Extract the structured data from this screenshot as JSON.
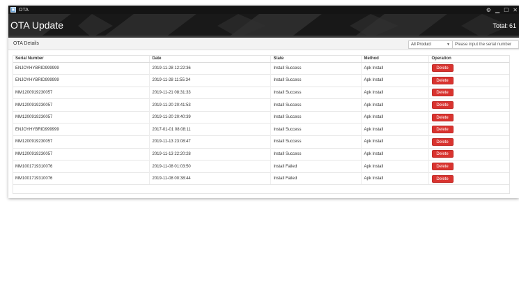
{
  "window": {
    "title": "OTA"
  },
  "header": {
    "title": "OTA Update",
    "total_label": "Total:",
    "total_value": "61"
  },
  "panel": {
    "title": "OTA Details",
    "product_select": {
      "selected": "All Product"
    },
    "serial_search": {
      "placeholder": "Please input the serial number"
    }
  },
  "table": {
    "columns": [
      "Serial Number",
      "Date",
      "State",
      "Method",
      "Operation"
    ],
    "delete_label": "Delete",
    "rows": [
      {
        "serial": "ENJOYHYBRID999999",
        "date": "2019-11-28 12:22:36",
        "state": "Install Success",
        "method": "Apk Install"
      },
      {
        "serial": "ENJOYHYBRID999999",
        "date": "2019-11-28 11:55:34",
        "state": "Install Success",
        "method": "Apk Install"
      },
      {
        "serial": "MM1200919230057",
        "date": "2019-11-21 08:31:33",
        "state": "Install Success",
        "method": "Apk Install"
      },
      {
        "serial": "MM1200919230057",
        "date": "2019-11-20 20:41:53",
        "state": "Install Success",
        "method": "Apk Install"
      },
      {
        "serial": "MM1200919230057",
        "date": "2019-11-20 20:40:39",
        "state": "Install Success",
        "method": "Apk Install"
      },
      {
        "serial": "ENJOYHYBRID999999",
        "date": "2017-01-01 08:08:11",
        "state": "Install Success",
        "method": "Apk Install"
      },
      {
        "serial": "MM1200919230057",
        "date": "2019-11-13 23:08:47",
        "state": "Install Success",
        "method": "Apk Install"
      },
      {
        "serial": "MM1200919230057",
        "date": "2019-11-13 22:20:28",
        "state": "Install Success",
        "method": "Apk Install"
      },
      {
        "serial": "MM1001719310076",
        "date": "2019-11-08 01:03:50",
        "state": "Install Failed",
        "method": "Apk Install"
      },
      {
        "serial": "MM1001719310076",
        "date": "2019-11-08 00:38:44",
        "state": "Install Failed",
        "method": "Apk Install"
      }
    ]
  },
  "icons": {
    "app": "app-icon",
    "minimize": "minimize-icon",
    "maximize": "maximize-icon",
    "close": "close-icon",
    "settings": "gear-icon",
    "dropdown": "chevron-down-icon"
  }
}
